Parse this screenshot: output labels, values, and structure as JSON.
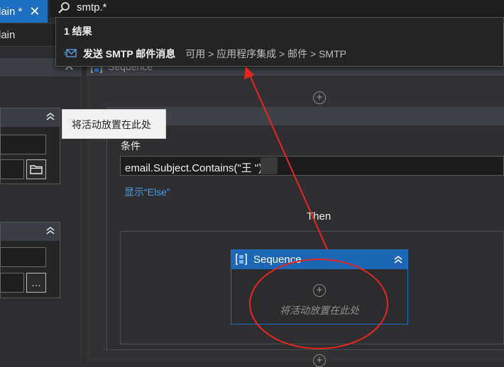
{
  "tab": {
    "title": "lain *",
    "close_glyph": "✕"
  },
  "subheader": {
    "title": "lain"
  },
  "left_panel": {
    "close_glyph": "✕",
    "browse_glyph": "…"
  },
  "search": {
    "query": "smtp.*",
    "result_count": "1 结果",
    "results": [
      {
        "name": "发送 SMTP 邮件消息",
        "path": "可用 > 应用程序集成 > 邮件 > SMTP",
        "icon": "mail-icon"
      }
    ]
  },
  "tooltip": {
    "text": "将活动放置在此处"
  },
  "workflow": {
    "outer_sequence_title": "Sequence",
    "condition_label": "条件",
    "condition_value": "email.Subject.Contains(\"王      \")",
    "show_else": "显示“Else”",
    "then_label": "Then",
    "inner_sequence": {
      "title": "Sequence",
      "drop_hint": "将活动放置在此处"
    }
  },
  "colors": {
    "accent": "#1e6fc2",
    "annotation_red": "#e8261f",
    "link": "#4c9be6"
  }
}
